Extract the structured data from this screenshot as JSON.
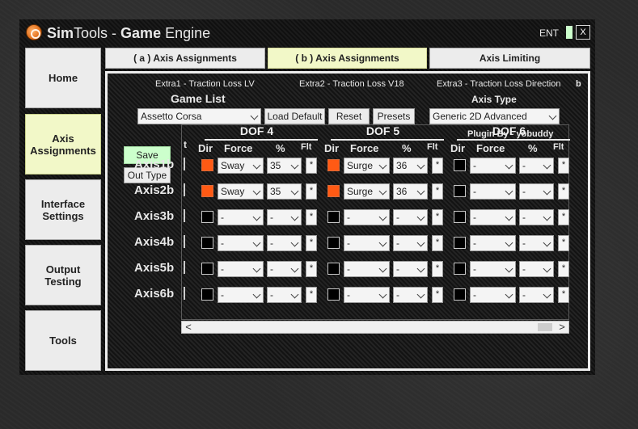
{
  "window": {
    "title_part1": "Sim",
    "title_part2": "Tools",
    "title_part3": " - ",
    "title_part4": "Game",
    "title_part5": " Engine",
    "ent_label": "ENT",
    "close_label": "X"
  },
  "nav": {
    "home": "Home",
    "axis_assignments": "Axis Assignments",
    "interface_settings": "Interface Settings",
    "output_testing": "Output Testing",
    "tools": "Tools"
  },
  "tabs": {
    "axis_a": "( a ) Axis Assignments",
    "axis_b": "( b ) Axis Assignments",
    "axis_limiting": "Axis Limiting"
  },
  "panel": {
    "extra1": "Extra1 - Traction Loss LV",
    "extra2": "Extra2 - Traction Loss V18",
    "extra3": "Extra3 - Traction Loss Direction",
    "b_marker": "b",
    "game_list_label": "Game List",
    "game_selected": "Assetto Corsa",
    "load_default": "Load Default",
    "reset": "Reset",
    "presets": "Presets",
    "axis_type_label": "Axis Type",
    "axis_type_selected": "Generic 2D Advanced",
    "plugin_by": "Plugin By - yobuddy",
    "save": "Save",
    "out_type": "Out Type"
  },
  "grid": {
    "dof_labels": [
      "DOF 4",
      "DOF 5",
      "DOF 6"
    ],
    "cut_header": "t",
    "headers": {
      "dir": "Dir",
      "force": "Force",
      "pct": "%",
      "flt": "Flt"
    },
    "flt_value": "*",
    "axes": [
      {
        "label": "Axis1b",
        "cells": [
          {
            "dir_on": true,
            "force": "Sway",
            "pct": "35"
          },
          {
            "dir_on": true,
            "force": "Surge",
            "pct": "36"
          },
          {
            "dir_on": false,
            "force": "-",
            "pct": "-"
          }
        ]
      },
      {
        "label": "Axis2b",
        "cells": [
          {
            "dir_on": true,
            "force": "Sway",
            "pct": "35"
          },
          {
            "dir_on": true,
            "force": "Surge",
            "pct": "36"
          },
          {
            "dir_on": false,
            "force": "-",
            "pct": "-"
          }
        ]
      },
      {
        "label": "Axis3b",
        "cells": [
          {
            "dir_on": false,
            "force": "-",
            "pct": "-"
          },
          {
            "dir_on": false,
            "force": "-",
            "pct": "-"
          },
          {
            "dir_on": false,
            "force": "-",
            "pct": "-"
          }
        ]
      },
      {
        "label": "Axis4b",
        "cells": [
          {
            "dir_on": false,
            "force": "-",
            "pct": "-"
          },
          {
            "dir_on": false,
            "force": "-",
            "pct": "-"
          },
          {
            "dir_on": false,
            "force": "-",
            "pct": "-"
          }
        ]
      },
      {
        "label": "Axis5b",
        "cells": [
          {
            "dir_on": false,
            "force": "-",
            "pct": "-"
          },
          {
            "dir_on": false,
            "force": "-",
            "pct": "-"
          },
          {
            "dir_on": false,
            "force": "-",
            "pct": "-"
          }
        ]
      },
      {
        "label": "Axis6b",
        "cells": [
          {
            "dir_on": false,
            "force": "-",
            "pct": "-"
          },
          {
            "dir_on": false,
            "force": "-",
            "pct": "-"
          },
          {
            "dir_on": false,
            "force": "-",
            "pct": "-"
          }
        ]
      }
    ]
  },
  "scrollbar": {
    "left_arrow": "<",
    "right_arrow": ">"
  },
  "colors": {
    "dir_on": "#ff5a14",
    "save_bg": "#ccffcc",
    "active_bg": "#f2f8c8"
  }
}
